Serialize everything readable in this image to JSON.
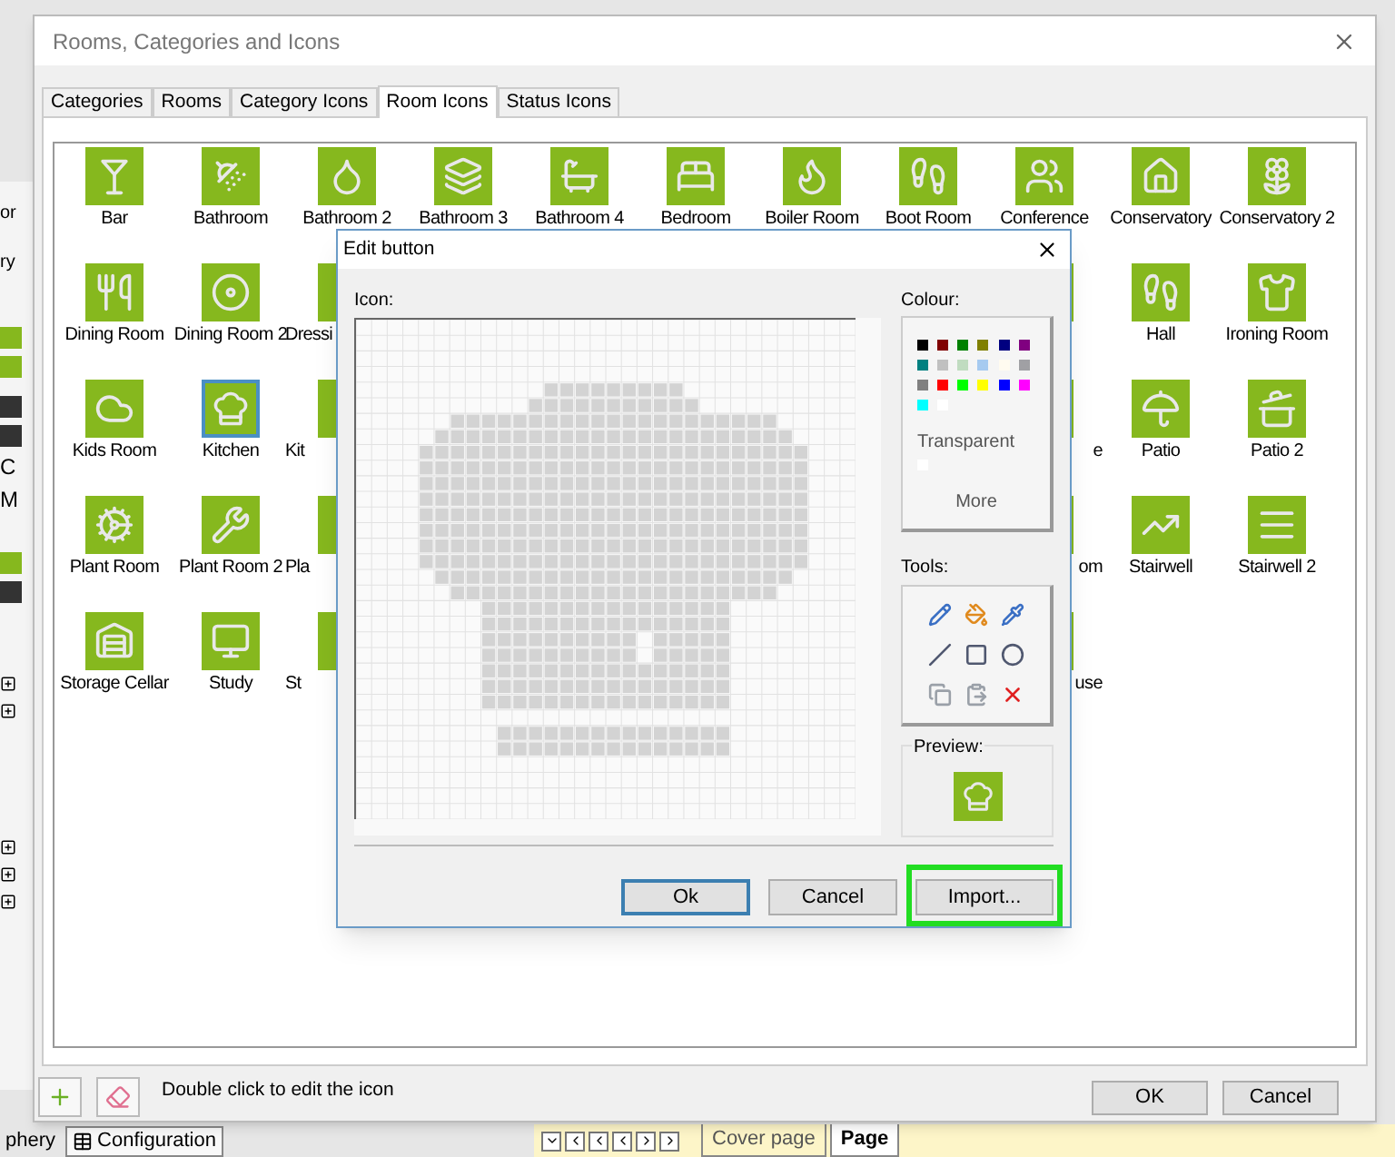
{
  "background_app": {
    "left_fragments": [
      "or",
      "ry",
      "C",
      "M"
    ],
    "bottom_tabs": [
      {
        "label": "phery",
        "selected": false
      },
      {
        "label": "Configuration",
        "selected": true
      }
    ],
    "page_tabs": [
      {
        "label": "Cover page",
        "selected": false
      },
      {
        "label": "Page",
        "selected": true
      }
    ]
  },
  "window": {
    "title": "Rooms, Categories and Icons"
  },
  "tabs": [
    {
      "label": "Categories",
      "selected": false
    },
    {
      "label": "Rooms",
      "selected": false
    },
    {
      "label": "Category Icons",
      "selected": false
    },
    {
      "label": "Room Icons",
      "selected": true
    },
    {
      "label": "Status Icons",
      "selected": false
    }
  ],
  "icon_grid": {
    "rows": [
      [
        {
          "kind": "full",
          "label": "Bar",
          "selected": false
        },
        {
          "kind": "full",
          "label": "Bathroom",
          "selected": false
        },
        {
          "kind": "full",
          "label": "Bathroom 2",
          "selected": false
        },
        {
          "kind": "full",
          "label": "Bathroom 3",
          "selected": false
        },
        {
          "kind": "full",
          "label": "Bathroom 4",
          "selected": false
        },
        {
          "kind": "full",
          "label": "Bedroom",
          "selected": false
        },
        {
          "kind": "full",
          "label": "Boiler Room",
          "selected": false
        },
        {
          "kind": "full",
          "label": "Boot Room",
          "selected": false
        },
        {
          "kind": "full",
          "label": "Conference",
          "selected": false
        },
        {
          "kind": "full",
          "label": "Conservatory",
          "selected": false
        },
        {
          "kind": "full",
          "label": "Conservatory 2",
          "selected": false
        }
      ],
      [
        {
          "kind": "full",
          "label": "Dining Room",
          "selected": false
        },
        {
          "kind": "full",
          "label": "Dining Room 2",
          "selected": false
        },
        {
          "kind": "clipped_left",
          "label": "Dressi"
        },
        {
          "kind": "covered"
        },
        {
          "kind": "covered"
        },
        {
          "kind": "covered"
        },
        {
          "kind": "covered"
        },
        {
          "kind": "covered"
        },
        {
          "kind": "covered_edge"
        },
        {
          "kind": "full",
          "label": "Hall",
          "selected": false
        },
        {
          "kind": "full",
          "label": "Ironing Room",
          "selected": false
        }
      ],
      [
        {
          "kind": "full",
          "label": "Kids Room",
          "selected": false
        },
        {
          "kind": "full",
          "label": "Kitchen",
          "selected": true
        },
        {
          "kind": "clipped_left",
          "label": "Kit"
        },
        {
          "kind": "covered"
        },
        {
          "kind": "covered"
        },
        {
          "kind": "covered"
        },
        {
          "kind": "covered"
        },
        {
          "kind": "covered"
        },
        {
          "kind": "clipped_right",
          "label": "e"
        },
        {
          "kind": "full",
          "label": "Patio",
          "selected": false
        },
        {
          "kind": "full",
          "label": "Patio 2",
          "selected": false
        }
      ],
      [
        {
          "kind": "full",
          "label": "Plant Room",
          "selected": false
        },
        {
          "kind": "full",
          "label": "Plant Room 2",
          "selected": false
        },
        {
          "kind": "clipped_left",
          "label": "Pla"
        },
        {
          "kind": "covered"
        },
        {
          "kind": "covered"
        },
        {
          "kind": "covered"
        },
        {
          "kind": "covered"
        },
        {
          "kind": "covered"
        },
        {
          "kind": "clipped_right",
          "label": "om"
        },
        {
          "kind": "full",
          "label": "Stairwell",
          "selected": false
        },
        {
          "kind": "full",
          "label": "Stairwell 2",
          "selected": false
        }
      ],
      [
        {
          "kind": "full",
          "label": "Storage Cellar",
          "selected": false
        },
        {
          "kind": "full",
          "label": "Study",
          "selected": false
        },
        {
          "kind": "clipped_left",
          "label": "St"
        },
        {
          "kind": "covered"
        },
        {
          "kind": "covered"
        },
        {
          "kind": "covered"
        },
        {
          "kind": "covered"
        },
        {
          "kind": "covered"
        },
        {
          "kind": "clipped_right",
          "label": "use"
        }
      ]
    ]
  },
  "hint": "Double click to edit the icon",
  "buttons": [
    {
      "label": "OK"
    },
    {
      "label": "Cancel"
    }
  ],
  "edit_dialog": {
    "title": "Edit button",
    "icon_label": "Icon:",
    "colour_label": "Colour:",
    "swatches": [
      {
        "color": "#000000"
      },
      {
        "color": "#800000"
      },
      {
        "color": "#008000"
      },
      {
        "color": "#808000"
      },
      {
        "color": "#000080"
      },
      {
        "color": "#800080"
      },
      {
        "color": "#008080"
      },
      {
        "color": "#c0c0c0"
      },
      {
        "color": "#c0dcc0"
      },
      {
        "color": "#a6caf0"
      },
      {
        "color": "#fffbf0"
      },
      {
        "color": "#a0a0a4"
      },
      {
        "color": "#808080"
      },
      {
        "color": "#ff0000"
      },
      {
        "color": "#00ff00"
      },
      {
        "color": "#ffff00"
      },
      {
        "color": "#0000ff"
      },
      {
        "color": "#ff00ff"
      },
      {
        "color": "#00ffff"
      },
      {
        "color": "#ffffff"
      }
    ],
    "transparent_label": "Transparent",
    "more_label": "More",
    "tools_label": "Tools:",
    "preview_label": "Preview:",
    "buttons": [
      {
        "label": "Ok",
        "default": true,
        "highlighted": false
      },
      {
        "label": "Cancel",
        "default": false,
        "highlighted": false
      },
      {
        "label": "Import...",
        "default": false,
        "highlighted": true
      }
    ]
  }
}
